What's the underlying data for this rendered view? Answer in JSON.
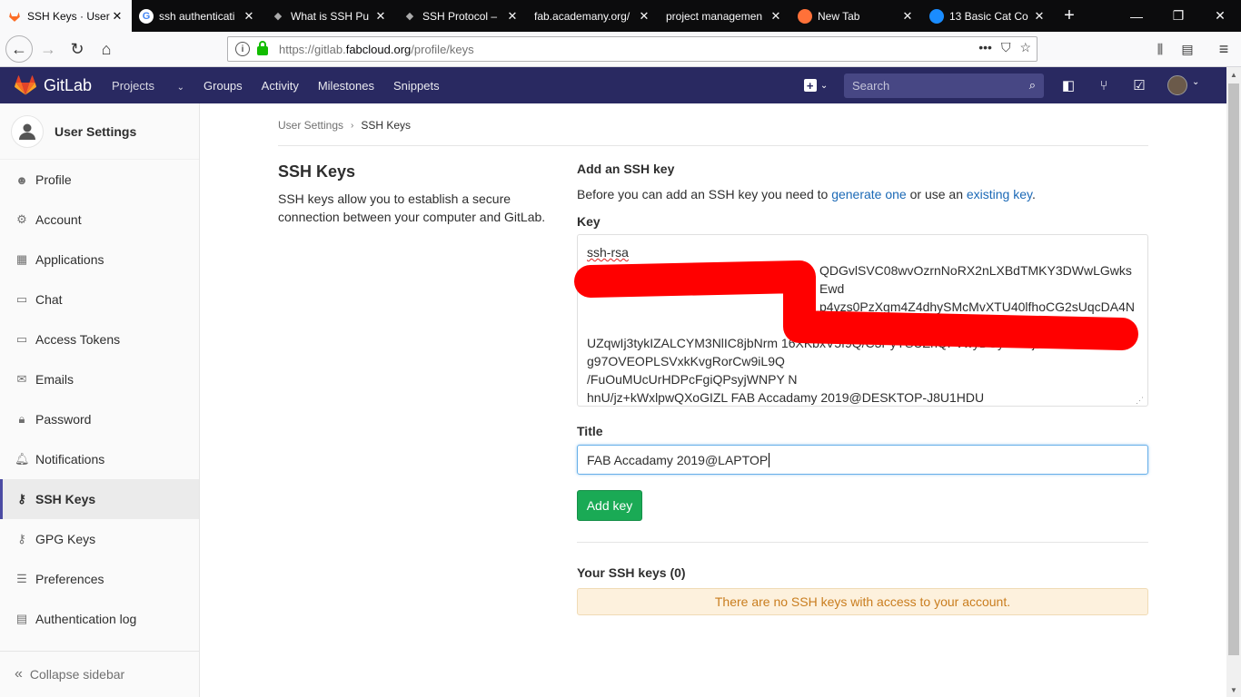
{
  "browser": {
    "tabs": [
      {
        "title": "SSH Keys · User",
        "favicon": "gitlab-icon",
        "active": true
      },
      {
        "title": "ssh authenticati",
        "favicon": "google-icon",
        "active": false
      },
      {
        "title": "What is SSH Pu",
        "favicon": "ssh-site-icon",
        "active": false
      },
      {
        "title": "SSH Protocol – ",
        "favicon": "ssh-site-icon",
        "active": false
      },
      {
        "title": "fab.academany.org/",
        "favicon": "",
        "active": false
      },
      {
        "title": "project managemen",
        "favicon": "",
        "active": false
      },
      {
        "title": "New Tab",
        "favicon": "firefox-icon",
        "active": false
      },
      {
        "title": "13 Basic Cat Co",
        "favicon": "onepassword-icon",
        "active": false
      }
    ],
    "url_prefix": "https://gitlab.",
    "url_host": "fabcloud.org",
    "url_path": "/profile/keys"
  },
  "header": {
    "brand": "GitLab",
    "nav": [
      "Projects",
      "Groups",
      "Activity",
      "Milestones",
      "Snippets"
    ],
    "search_placeholder": "Search",
    "colors": {
      "header_bg": "#292961",
      "accent": "#4b4ba3"
    }
  },
  "sidebar": {
    "title": "User Settings",
    "items": [
      {
        "label": "Profile",
        "icon": "profile-icon"
      },
      {
        "label": "Account",
        "icon": "account-icon"
      },
      {
        "label": "Applications",
        "icon": "applications-icon"
      },
      {
        "label": "Chat",
        "icon": "chat-icon"
      },
      {
        "label": "Access Tokens",
        "icon": "access-tokens-icon"
      },
      {
        "label": "Emails",
        "icon": "emails-icon"
      },
      {
        "label": "Password",
        "icon": "password-icon"
      },
      {
        "label": "Notifications",
        "icon": "notifications-icon"
      },
      {
        "label": "SSH Keys",
        "icon": "ssh-keys-icon",
        "active": true
      },
      {
        "label": "GPG Keys",
        "icon": "gpg-keys-icon"
      },
      {
        "label": "Preferences",
        "icon": "preferences-icon"
      },
      {
        "label": "Authentication log",
        "icon": "authentication-log-icon"
      }
    ],
    "collapse_label": "Collapse sidebar"
  },
  "breadcrumb": {
    "parent": "User Settings",
    "current": "SSH Keys"
  },
  "intro": {
    "title": "SSH Keys",
    "description": "SSH keys allow you to establish a secure connection between your computer and GitLab."
  },
  "form": {
    "heading": "Add an SSH key",
    "desc_before": "Before you can add an SSH key you need to ",
    "link_generate": "generate one",
    "desc_middle": " or use an ",
    "link_existing": "existing key",
    "desc_after": ".",
    "key_label": "Key",
    "key_lines": [
      "ssh-rsa",
      "QDGvlSVC08wvOzrnNoRX2nLXBdTMKY3DWwLGwksEwd",
      "p4vzs0PzXgm4Z4dhySMcMvXTU40lfhoCG2sUqcDA4NU",
      "UZqwIj3tykIZALCYM3NlIC8jbNrm 16XKbxV5f9Q/C3PyYSUZhQFVwyDUyxWOjTFSJAFtc1+M",
      "g97OVEOPLSVxkKvgRorCw9iL9Q",
      "/FuOuMUcUrHDPcFgiQPsyjWNPY N",
      "hnU/jz+kWxlpwQXoGIZL FAB Accadamy 2019@DESKTOP-J8U1HDU"
    ],
    "title_label": "Title",
    "title_value": "FAB Accadamy 2019@LAPTOP",
    "submit_label": "Add key"
  },
  "keys_list": {
    "heading": "Your SSH keys (0)",
    "empty_message": "There are no SSH keys with access to your account."
  }
}
